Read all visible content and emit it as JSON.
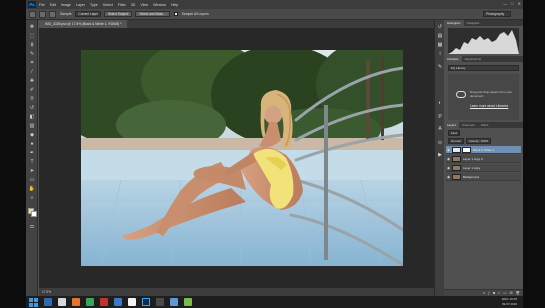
{
  "app": {
    "logo": "Ps",
    "menu": [
      "File",
      "Edit",
      "Image",
      "Layer",
      "Type",
      "Select",
      "Filter",
      "3D",
      "View",
      "Window",
      "Help"
    ],
    "window_buttons": [
      "—",
      "□",
      "✕"
    ]
  },
  "options": {
    "sample_label": "Sample:",
    "sample_value": "Current Layer",
    "refine_button": "Select Subject",
    "mask_button": "Select and Mask...",
    "enhance_label": "Sample All Layers",
    "workspace": "Photography"
  },
  "document": {
    "tab_title": "IMG_4329.psd @ 17.5% (Black & White 1, RGB/8) *",
    "status": "17.5%"
  },
  "panels": {
    "top_tabs": [
      "Histogram",
      "Navigator"
    ],
    "lib_tabs": [
      "Libraries",
      "Adjustments"
    ],
    "library_select": "My Library",
    "cc_text": "Drag and drop assets from your document",
    "cc_link": "Learn more about Libraries",
    "layer_tabs": [
      "Layers",
      "Channels",
      "Paths"
    ],
    "kind_select": "Kind",
    "blend_mode": "Normal",
    "opacity": "Opacity: 100%",
    "layers": [
      {
        "name": "Black & White 1",
        "type": "adjustment",
        "selected": true
      },
      {
        "name": "Layer 1 copy 2",
        "type": "pixel",
        "selected": false
      },
      {
        "name": "Layer 1 copy",
        "type": "pixel",
        "selected": false
      },
      {
        "name": "Background",
        "type": "pixel",
        "selected": false
      }
    ]
  },
  "taskbar": {
    "time": "10:45",
    "date": "09.07.2016",
    "lang": "ENG"
  },
  "colors": {
    "accent": "#31a8ff",
    "selection": "#6f8fb4",
    "photo_sky": "#bcd6e6",
    "photo_foliage": "#2f4a25"
  }
}
